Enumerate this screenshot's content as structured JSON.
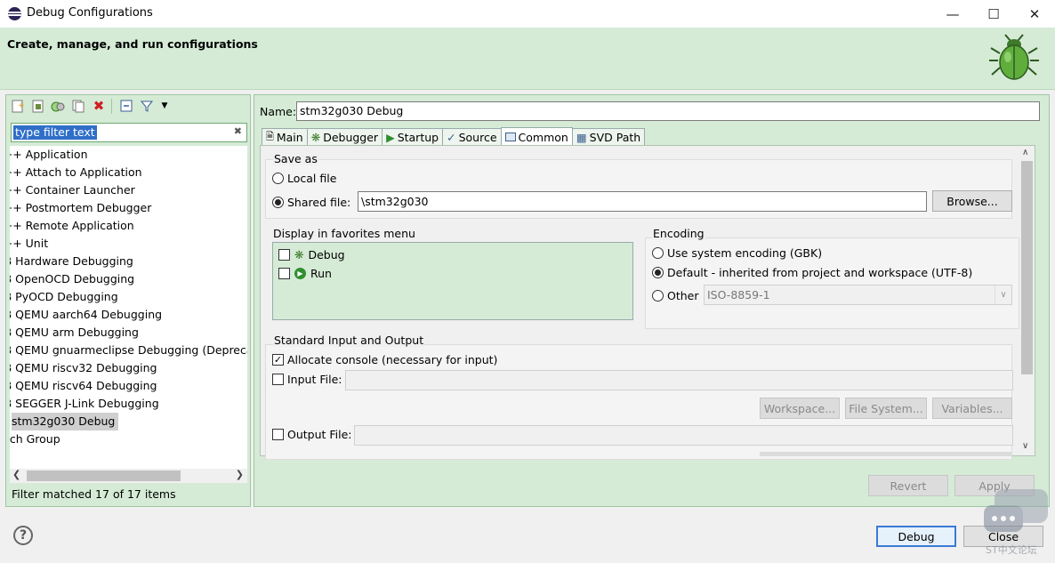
{
  "window": {
    "title": "Debug Configurations"
  },
  "header": {
    "title": "Create, manage, and run configurations"
  },
  "filter": {
    "text": "type filter text"
  },
  "tree": {
    "items": [
      {
        "label": "C++ Application"
      },
      {
        "label": "C++ Attach to Application"
      },
      {
        "label": "C++ Container Launcher"
      },
      {
        "label": "C++ Postmortem Debugger"
      },
      {
        "label": "C++ Remote Application"
      },
      {
        "label": "C++ Unit"
      },
      {
        "label": "DB Hardware Debugging"
      },
      {
        "label": "DB OpenOCD Debugging"
      },
      {
        "label": "DB PyOCD Debugging"
      },
      {
        "label": "DB QEMU aarch64 Debugging"
      },
      {
        "label": "DB QEMU arm Debugging"
      },
      {
        "label": "DB QEMU gnuarmeclipse Debugging (Deprecated)"
      },
      {
        "label": "DB QEMU riscv32 Debugging"
      },
      {
        "label": "DB QEMU riscv64 Debugging"
      },
      {
        "label": "DB SEGGER J-Link Debugging"
      },
      {
        "label": "stm32g030 Debug"
      },
      {
        "label": "unch Group"
      }
    ],
    "status": "Filter matched 17 of 17 items"
  },
  "config": {
    "name_label": "Name:",
    "name_value": "stm32g030 Debug",
    "tabs": [
      "Main",
      "Debugger",
      "Startup",
      "Source",
      "Common",
      "SVD Path"
    ],
    "active_tab": "Common"
  },
  "save_as": {
    "legend": "Save as",
    "local_label": "Local file",
    "shared_label": "Shared file:",
    "shared_value": "\\stm32g030",
    "browse": "Browse..."
  },
  "favorites": {
    "legend": "Display in favorites menu",
    "items": [
      "Debug",
      "Run"
    ]
  },
  "encoding": {
    "legend": "Encoding",
    "system": "Use system encoding (GBK)",
    "default": "Default - inherited from project and workspace (UTF-8)",
    "other": "Other",
    "other_value": "ISO-8859-1"
  },
  "std_io": {
    "legend": "Standard Input and Output",
    "allocate": "Allocate console (necessary for input)",
    "input_file": "Input File:",
    "output_file": "Output File:",
    "workspace": "Workspace...",
    "file_system": "File System...",
    "variables": "Variables..."
  },
  "buttons": {
    "revert": "Revert",
    "apply": "Apply",
    "debug": "Debug",
    "close": "Close"
  },
  "watermark": {
    "text": "ST中文论坛"
  },
  "colors": {
    "accent_green": "#d5ebd6",
    "selection": "#2f6fc9"
  }
}
